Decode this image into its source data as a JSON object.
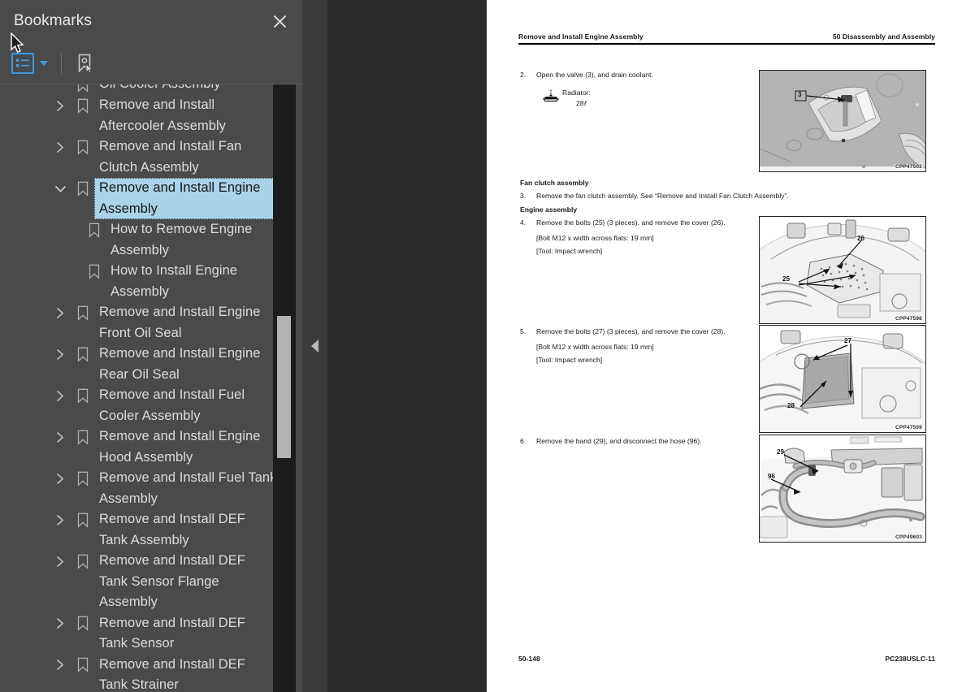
{
  "sidebar": {
    "title": "Bookmarks",
    "close_label": "Close",
    "toolbar": {
      "outline_view_label": "Bookmark options",
      "bookmark_tool_label": "New bookmark"
    },
    "items": [
      {
        "label": "Oil Cooler Assembly",
        "level": 0,
        "twisty": "none",
        "selected": false,
        "clipped": true
      },
      {
        "label": "Remove and Install Aftercooler Assembly",
        "level": 0,
        "twisty": "collapsed",
        "selected": false
      },
      {
        "label": "Remove and Install Fan Clutch Assembly",
        "level": 0,
        "twisty": "collapsed",
        "selected": false
      },
      {
        "label": "Remove and Install Engine Assembly",
        "level": 0,
        "twisty": "expanded",
        "selected": true
      },
      {
        "label": "How to Remove Engine Assembly",
        "level": 1,
        "twisty": "none",
        "selected": false
      },
      {
        "label": "How to Install Engine Assembly",
        "level": 1,
        "twisty": "none",
        "selected": false
      },
      {
        "label": "Remove and Install Engine Front Oil Seal",
        "level": 0,
        "twisty": "collapsed",
        "selected": false
      },
      {
        "label": "Remove and Install Engine Rear Oil Seal",
        "level": 0,
        "twisty": "collapsed",
        "selected": false
      },
      {
        "label": "Remove and Install Fuel Cooler Assembly",
        "level": 0,
        "twisty": "collapsed",
        "selected": false
      },
      {
        "label": "Remove and Install Engine Hood Assembly",
        "level": 0,
        "twisty": "collapsed",
        "selected": false
      },
      {
        "label": "Remove and Install Fuel Tank Assembly",
        "level": 0,
        "twisty": "collapsed",
        "selected": false
      },
      {
        "label": "Remove and Install DEF Tank Assembly",
        "level": 0,
        "twisty": "collapsed",
        "selected": false
      },
      {
        "label": "Remove and Install DEF Tank Sensor Flange Assembly",
        "level": 0,
        "twisty": "collapsed",
        "selected": false
      },
      {
        "label": "Remove and Install DEF Tank Sensor",
        "level": 0,
        "twisty": "collapsed",
        "selected": false
      },
      {
        "label": "Remove and Install DEF Tank Strainer",
        "level": 0,
        "twisty": "collapsed",
        "selected": false
      }
    ]
  },
  "collapse_handle": {
    "label": "Collapse sidebar"
  },
  "document": {
    "header": {
      "left": "Remove and Install Engine Assembly",
      "right": "50 Disassembly and Assembly"
    },
    "steps": [
      {
        "number": "2.",
        "text": "Open the valve (3), and drain coolant.",
        "note_label": "Radiator:",
        "note_value": "28",
        "note_unit": "ℓ"
      },
      {
        "heading": "Fan clutch assembly",
        "number": "3.",
        "text": "Remove the fan clutch assembly. See “Remove and Install Fan Clutch Assembly”."
      },
      {
        "heading": "Engine assembly",
        "number": "4.",
        "text": "Remove the bolts (25) (3 pieces), and remove the cover (26).",
        "spec1": "[Bolt M12 x width across flats: 19 mm]",
        "spec2": "[Tool: Impact wrench]"
      },
      {
        "number": "5.",
        "text": "Remove the bolts (27) (3 pieces), and remove the cover (28).",
        "spec1": "[Bolt M12 x width across flats: 19 mm]",
        "spec2": "[Tool: Impact wrench]"
      },
      {
        "number": "6.",
        "text": "Remove the band (29), and disconnect the hose (96)."
      }
    ],
    "figures": [
      {
        "code": "CPP47502",
        "callouts": [
          "3"
        ]
      },
      {
        "code": "CPP47598",
        "callouts": [
          "26",
          "25"
        ]
      },
      {
        "code": "CPP47599",
        "callouts": [
          "27",
          "28"
        ]
      },
      {
        "code": "CPP49603",
        "callouts": [
          "29",
          "96"
        ]
      }
    ],
    "footer": {
      "left": "50-148",
      "right": "PC238USLC-11"
    }
  },
  "colors": {
    "sidebar_bg": "#4a4a4a",
    "viewer_bg": "#2b2b2b",
    "accent_blue": "#3d9ae2",
    "selection_blue": "#a8d3e8",
    "scrollbar_track": "#1c1c1c",
    "scrollbar_thumb": "#b4b4b4"
  }
}
